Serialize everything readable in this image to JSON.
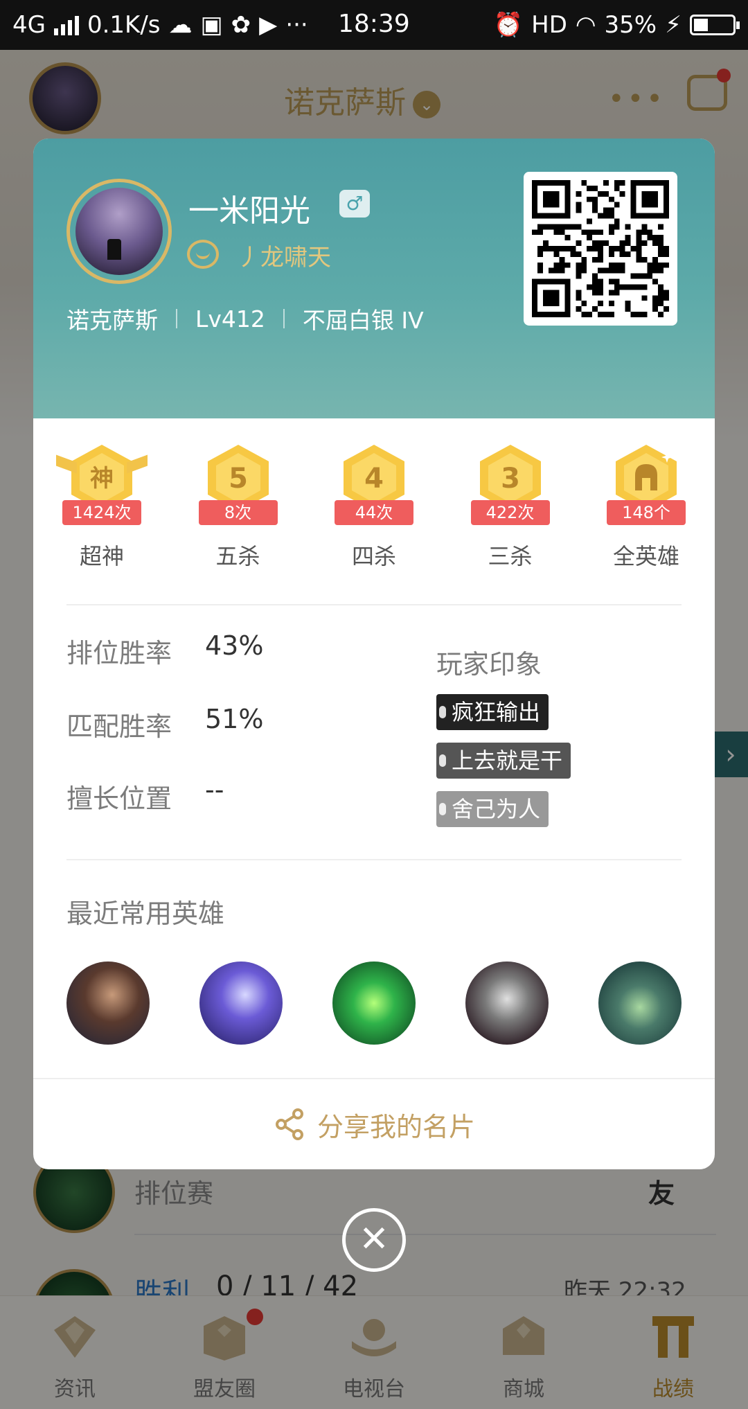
{
  "status_bar": {
    "network": "4G",
    "speed": "0.1K/s",
    "time": "18:39",
    "hd": "HD",
    "battery": "35%"
  },
  "background": {
    "title": "诺克萨斯",
    "row1_mode": "排位赛",
    "row1_friend": "友",
    "row2_result": "胜利",
    "row2_kda": "0 / 11 / 42",
    "row2_time": "昨天 22:32",
    "tabs": [
      {
        "label": "资讯"
      },
      {
        "label": "盟友圈"
      },
      {
        "label": "电视台"
      },
      {
        "label": "商城"
      },
      {
        "label": "战绩"
      }
    ]
  },
  "profile": {
    "name": "一米阳光",
    "gender_symbol": "♂",
    "club": "丿龙啸天",
    "server": "诺克萨斯",
    "level": "Lv412",
    "rank": "不屈白银 IV"
  },
  "achievements": [
    {
      "emblem": "神",
      "count": "1424次",
      "label": "超神"
    },
    {
      "emblem": "5",
      "count": "8次",
      "label": "五杀"
    },
    {
      "emblem": "4",
      "count": "44次",
      "label": "四杀"
    },
    {
      "emblem": "3",
      "count": "422次",
      "label": "三杀"
    },
    {
      "emblem": "helmet-icon",
      "count": "148个",
      "label": "全英雄"
    }
  ],
  "stats": {
    "ranked_label": "排位胜率",
    "ranked_value": "43%",
    "match_label": "匹配胜率",
    "match_value": "51%",
    "position_label": "擅长位置",
    "position_value": "--"
  },
  "impressions": {
    "title": "玩家印象",
    "tags": [
      {
        "text": "疯狂输出",
        "color": "#222222"
      },
      {
        "text": "上去就是干",
        "color": "#555555"
      },
      {
        "text": "舍己为人",
        "color": "#999999"
      }
    ]
  },
  "recent_heroes": {
    "title": "最近常用英雄"
  },
  "share_label": "分享我的名片",
  "colors": {
    "header_teal": "#5daaa9",
    "gold": "#c3a063",
    "ribbon_red": "#ef5d5d",
    "emblem_yellow": "#f7c843"
  }
}
